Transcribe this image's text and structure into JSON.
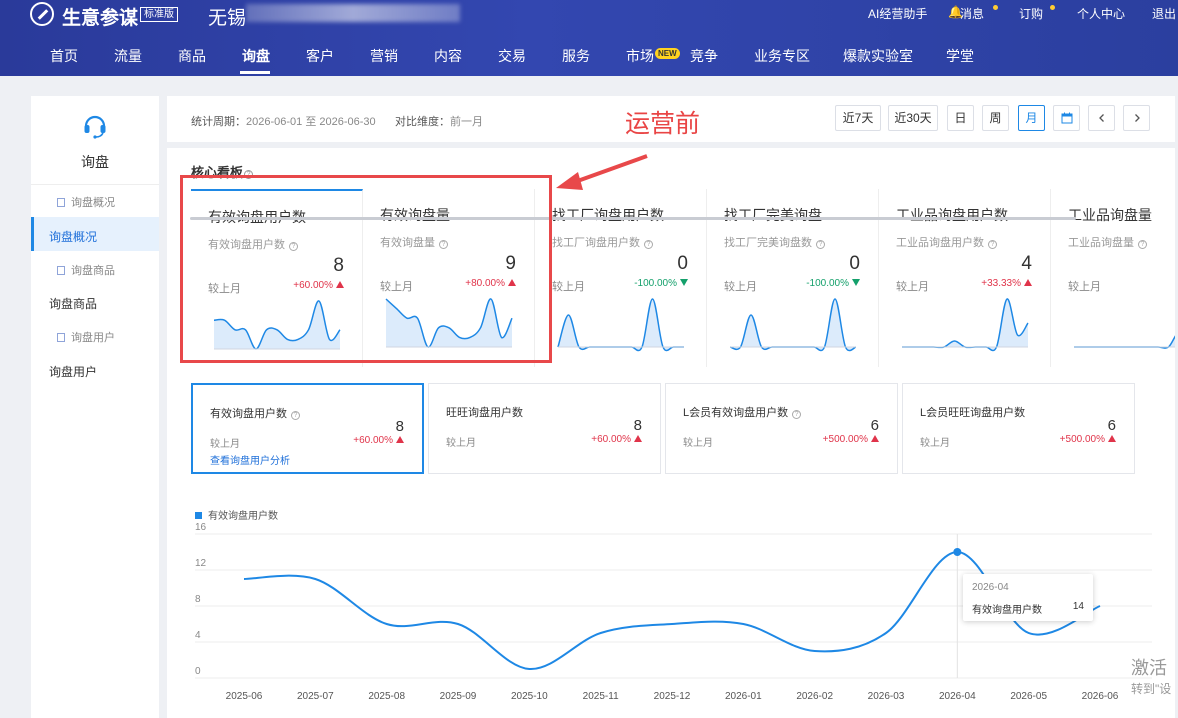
{
  "header": {
    "brand": "生意参谋",
    "edition": "标准版",
    "shop_prefix": "无锡",
    "top_links": [
      "AI经营助手",
      "消息",
      "订购",
      "个人中心",
      "退出"
    ],
    "nav": [
      "首页",
      "流量",
      "商品",
      "询盘",
      "客户",
      "营销",
      "内容",
      "交易",
      "服务",
      "市场",
      "竞争",
      "业务专区",
      "爆款实验室",
      "学堂"
    ],
    "nav_active": "询盘",
    "new_badge": "NEW"
  },
  "sidebar": {
    "title": "询盘",
    "items": [
      {
        "label": "询盘概况",
        "type": "sub"
      },
      {
        "label": "询盘概况",
        "type": "active"
      },
      {
        "label": "询盘商品",
        "type": "sub"
      },
      {
        "label": "询盘商品",
        "type": "item"
      },
      {
        "label": "询盘用户",
        "type": "sub"
      },
      {
        "label": "询盘用户",
        "type": "item"
      }
    ]
  },
  "filter": {
    "period_label": "统计周期：",
    "period_value": "2026-06-01 至 2026-06-30",
    "compare_label": "对比维度：",
    "compare_value": "前一月",
    "annotation": "运营前",
    "buttons": [
      "近7天",
      "近30天",
      "日",
      "周",
      "月"
    ],
    "active_button": "月"
  },
  "core_board": {
    "title": "核心看板",
    "kpis": [
      {
        "title": "有效询盘用户数",
        "sub": "有效询盘用户数",
        "value": "8",
        "cmp": "较上月",
        "change": "+60.00%",
        "dir": "up",
        "spark": [
          3,
          3,
          2,
          2,
          0,
          2,
          2,
          1,
          1,
          2,
          5,
          1,
          2
        ]
      },
      {
        "title": "有效询盘量",
        "sub": "有效询盘量",
        "value": "9",
        "cmp": "较上月",
        "change": "+80.00%",
        "dir": "up",
        "spark": [
          5,
          4,
          3,
          3,
          0,
          2,
          2,
          1,
          1,
          2,
          5,
          1,
          3
        ]
      },
      {
        "title": "找工厂询盘用户数",
        "sub": "找工厂询盘用户数",
        "value": "0",
        "cmp": "较上月",
        "change": "-100.00%",
        "dir": "down",
        "spark": [
          0,
          2,
          0,
          0,
          0,
          0,
          0,
          0,
          0,
          3,
          0,
          0,
          0
        ]
      },
      {
        "title": "找工厂完美询盘",
        "sub": "找工厂完美询盘数",
        "value": "0",
        "cmp": "较上月",
        "change": "-100.00%",
        "dir": "down",
        "spark": [
          0,
          0,
          2,
          0,
          0,
          0,
          0,
          0,
          0,
          0,
          3,
          0,
          0
        ]
      },
      {
        "title": "工业品询盘用户数",
        "sub": "工业品询盘用户数",
        "value": "4",
        "cmp": "较上月",
        "change": "+33.33%",
        "dir": "up",
        "spark": [
          0,
          0,
          0,
          0,
          0,
          0.5,
          0,
          0,
          0,
          0,
          4,
          1,
          2
        ]
      },
      {
        "title": "工业品询盘量",
        "sub": "工业品询盘量",
        "value": "",
        "cmp": "较上月",
        "change": "",
        "dir": "up",
        "spark": [
          0,
          0,
          0,
          0,
          0,
          0,
          0,
          0,
          0,
          0,
          0.3,
          0,
          0
        ]
      }
    ]
  },
  "metric_cards": [
    {
      "title": "有效询盘用户数",
      "has_help": true,
      "value": "8",
      "cmp": "较上月",
      "change": "+60.00%",
      "link": "查看询盘用户分析"
    },
    {
      "title": "旺旺询盘用户数",
      "has_help": false,
      "value": "8",
      "cmp": "较上月",
      "change": "+60.00%",
      "link": ""
    },
    {
      "title": "L会员有效询盘用户数",
      "has_help": true,
      "value": "6",
      "cmp": "较上月",
      "change": "+500.00%",
      "link": ""
    },
    {
      "title": "L会员旺旺询盘用户数",
      "has_help": false,
      "value": "6",
      "cmp": "较上月",
      "change": "+500.00%",
      "link": ""
    }
  ],
  "chart_data": {
    "type": "line",
    "title": "",
    "legend": [
      "有效询盘用户数"
    ],
    "x": [
      "2025-06",
      "2025-07",
      "2025-08",
      "2025-09",
      "2025-10",
      "2025-11",
      "2025-12",
      "2026-01",
      "2026-02",
      "2026-03",
      "2026-04",
      "2026-05",
      "2026-06"
    ],
    "series": [
      {
        "name": "有效询盘用户数",
        "values": [
          11,
          11,
          6,
          6,
          1,
          5,
          6,
          6,
          3,
          5,
          14,
          5,
          8
        ]
      }
    ],
    "ylim": [
      0,
      16
    ],
    "yticks": [
      0,
      4,
      8,
      12,
      16
    ],
    "grid": true,
    "highlight_index": 10,
    "color": "#1e88e5"
  },
  "tooltip": {
    "title": "2026-04",
    "label": "有效询盘用户数",
    "value": "14"
  },
  "watermark": {
    "line1": "激活",
    "line2": "转到\"设"
  }
}
